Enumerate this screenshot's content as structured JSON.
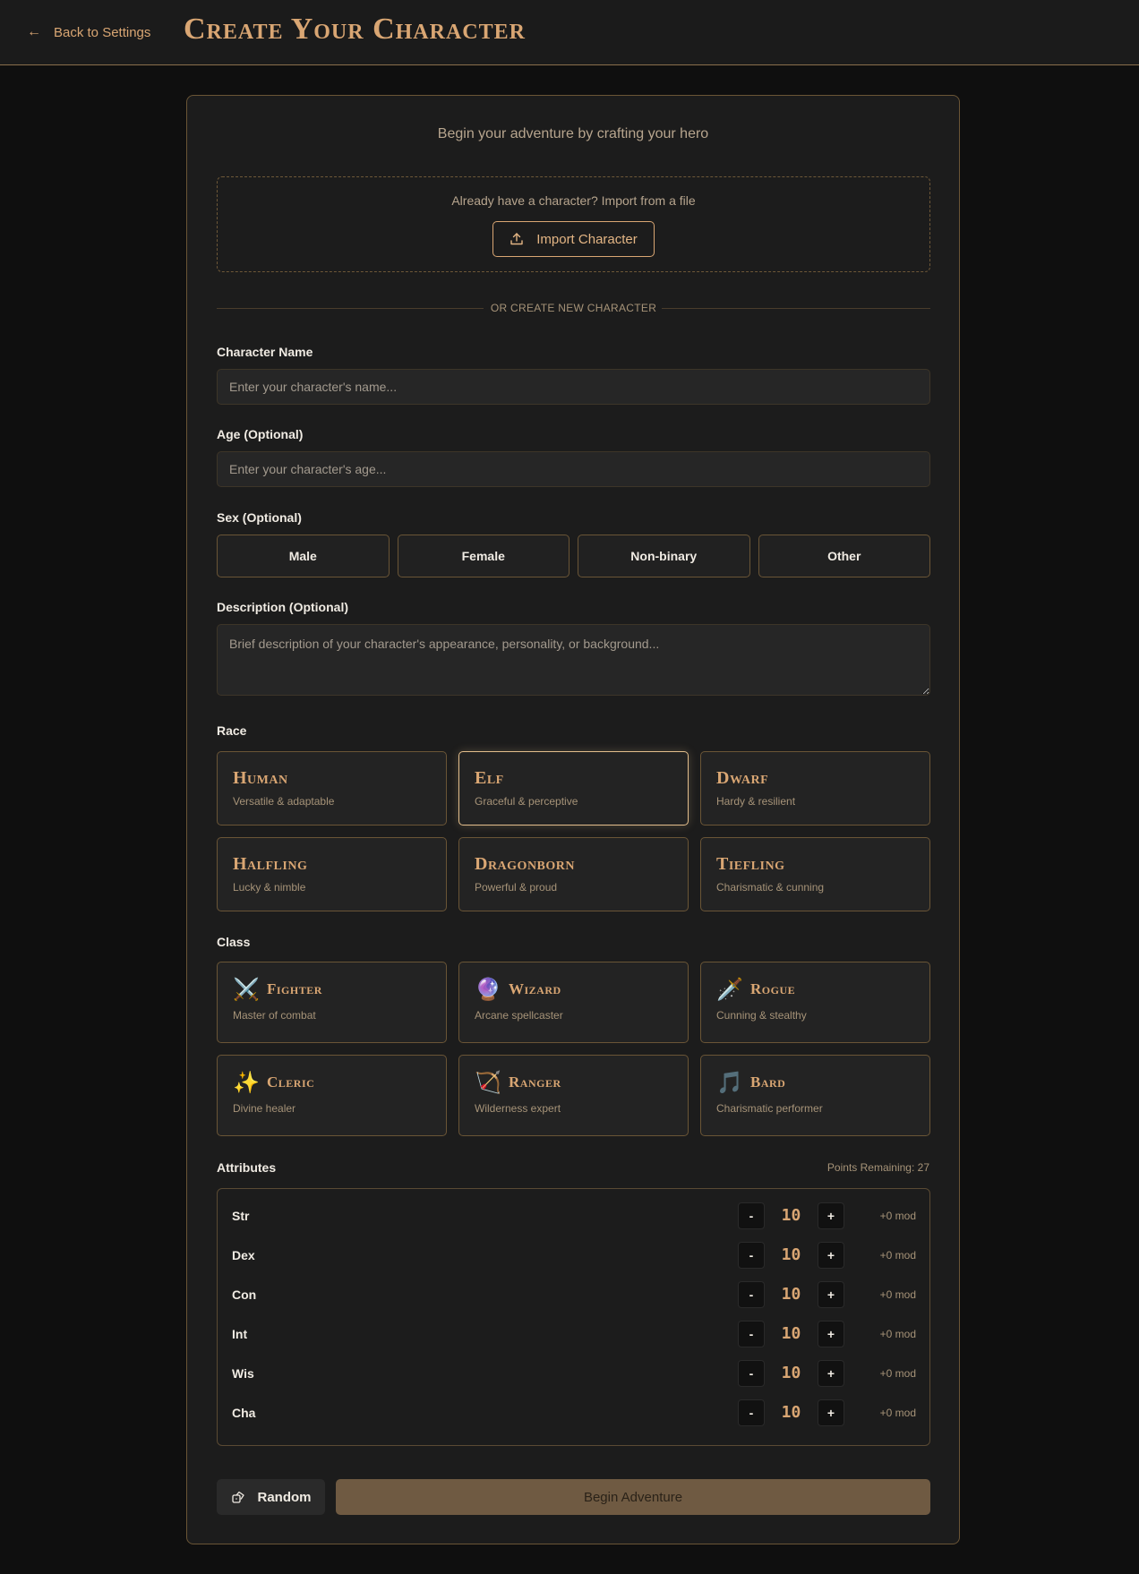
{
  "header": {
    "back_label": "Back to Settings",
    "back_icon": "arrow-left-icon",
    "title": "Create Your Character"
  },
  "form": {
    "subtitle": "Begin your adventure by crafting your hero",
    "import": {
      "prompt": "Already have a character? Import from a file",
      "button_label": "Import Character",
      "icon": "upload-icon"
    },
    "divider_text": "OR CREATE NEW CHARACTER",
    "name": {
      "label": "Character Name",
      "placeholder": "Enter your character's name...",
      "value": ""
    },
    "age": {
      "label": "Age (Optional)",
      "placeholder": "Enter your character's age...",
      "value": ""
    },
    "sex": {
      "label": "Sex (Optional)",
      "options": [
        "Male",
        "Female",
        "Non-binary",
        "Other"
      ]
    },
    "description": {
      "label": "Description (Optional)",
      "placeholder": "Brief description of your character's appearance, personality, or background...",
      "value": ""
    },
    "race": {
      "label": "Race",
      "selected": "Elf",
      "options": [
        {
          "name": "Human",
          "desc": "Versatile & adaptable"
        },
        {
          "name": "Elf",
          "desc": "Graceful & perceptive"
        },
        {
          "name": "Dwarf",
          "desc": "Hardy & resilient"
        },
        {
          "name": "Halfling",
          "desc": "Lucky & nimble"
        },
        {
          "name": "Dragonborn",
          "desc": "Powerful & proud"
        },
        {
          "name": "Tiefling",
          "desc": "Charismatic & cunning"
        }
      ]
    },
    "class": {
      "label": "Class",
      "options": [
        {
          "name": "Fighter",
          "desc": "Master of combat",
          "icon": "⚔️"
        },
        {
          "name": "Wizard",
          "desc": "Arcane spellcaster",
          "icon": "🔮"
        },
        {
          "name": "Rogue",
          "desc": "Cunning & stealthy",
          "icon": "🗡️"
        },
        {
          "name": "Cleric",
          "desc": "Divine healer",
          "icon": "✨"
        },
        {
          "name": "Ranger",
          "desc": "Wilderness expert",
          "icon": "🏹"
        },
        {
          "name": "Bard",
          "desc": "Charismatic performer",
          "icon": "🎵"
        }
      ]
    },
    "attributes": {
      "label": "Attributes",
      "points_remaining": "Points Remaining: 27",
      "minus_label": "-",
      "plus_label": "+",
      "list": [
        {
          "name": "Str",
          "value": "10",
          "mod": "+0 mod"
        },
        {
          "name": "Dex",
          "value": "10",
          "mod": "+0 mod"
        },
        {
          "name": "Con",
          "value": "10",
          "mod": "+0 mod"
        },
        {
          "name": "Int",
          "value": "10",
          "mod": "+0 mod"
        },
        {
          "name": "Wis",
          "value": "10",
          "mod": "+0 mod"
        },
        {
          "name": "Cha",
          "value": "10",
          "mod": "+0 mod"
        }
      ]
    },
    "random_label": "Random",
    "random_icon": "dice-icon",
    "begin_label": "Begin Adventure"
  },
  "colors": {
    "accent": "#d9a673",
    "background": "#0f0f0f",
    "card": "#1c1c1c",
    "border": "#6a5536",
    "begin_button": "#6f5a42"
  }
}
